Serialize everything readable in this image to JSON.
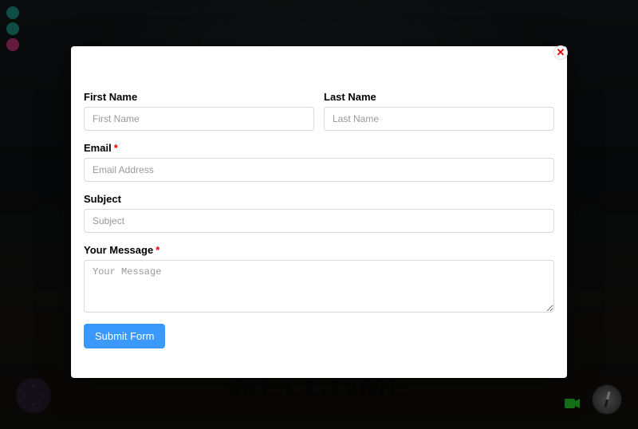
{
  "background": {
    "welcome_text": "WELCOME"
  },
  "modal": {
    "close_glyph": "✕"
  },
  "form": {
    "first_name": {
      "label": "First Name",
      "placeholder": "First Name",
      "value": ""
    },
    "last_name": {
      "label": "Last Name",
      "placeholder": "Last Name",
      "value": ""
    },
    "email": {
      "label": "Email",
      "placeholder": "Email Address",
      "value": "",
      "required_mark": "*"
    },
    "subject": {
      "label": "Subject",
      "placeholder": "Subject",
      "value": ""
    },
    "message": {
      "label": "Your Message",
      "placeholder": "Your Message",
      "value": "",
      "required_mark": "*"
    },
    "submit_label": "Submit Form"
  },
  "controls": {
    "nav_arrows": {
      "up": "⌃",
      "down": "⌄",
      "left": "‹",
      "right": "›"
    },
    "camera_glyph": "■"
  }
}
